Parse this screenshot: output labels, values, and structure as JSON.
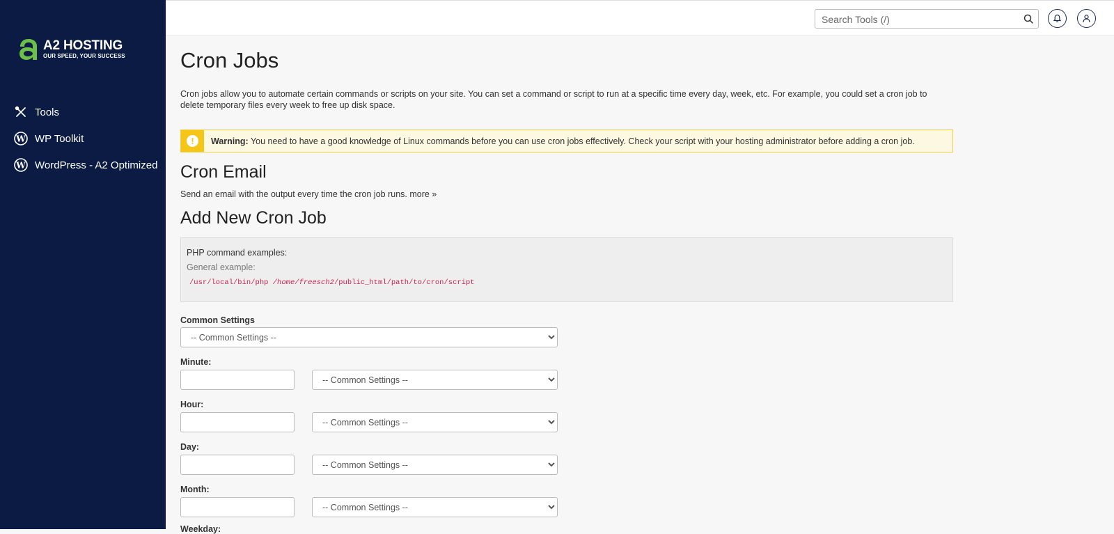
{
  "brand": {
    "name": "A2 HOSTING",
    "tagline": "OUR SPEED, YOUR SUCCESS",
    "colors": {
      "sidebar": "#0b1b44",
      "logo_green": "#6cc04a",
      "warning_yellow": "#f5c518"
    }
  },
  "sidebar": {
    "items": [
      {
        "label": "Tools",
        "icon": "tools-icon"
      },
      {
        "label": "WP Toolkit",
        "icon": "wordpress-icon"
      },
      {
        "label": "WordPress - A2 Optimized",
        "icon": "wordpress-icon"
      }
    ]
  },
  "topbar": {
    "search_placeholder": "Search Tools (/)",
    "icons": [
      "search-icon",
      "bell-icon",
      "user-icon"
    ]
  },
  "page": {
    "title": "Cron Jobs",
    "intro": "Cron jobs allow you to automate certain commands or scripts on your site. You can set a command or script to run at a specific time every day, week, etc. For example, you could set a cron job to delete temporary files every week to free up disk space.",
    "warning_label": "Warning:",
    "warning_text": " You need to have a good knowledge of Linux commands before you can use cron jobs effectively. Check your script with your hosting administrator before adding a cron job."
  },
  "cron_email": {
    "heading": "Cron Email",
    "description": "Send an email with the output every time the cron job runs.",
    "more_link": "more »"
  },
  "add_job": {
    "heading": "Add New Cron Job",
    "examples_heading": "PHP command examples:",
    "general_example_label": "General example:",
    "code_prefix": "/usr/local/bin/php ",
    "code_home": "/home/freesch2",
    "code_suffix": "/public_html/path/to/cron/script",
    "common_settings_label": "Common Settings",
    "common_settings_value": "-- Common Settings --",
    "fields": [
      {
        "label": "Minute:",
        "value": "",
        "select_value": "-- Common Settings --"
      },
      {
        "label": "Hour:",
        "value": "",
        "select_value": "-- Common Settings --"
      },
      {
        "label": "Day:",
        "value": "",
        "select_value": "-- Common Settings --"
      },
      {
        "label": "Month:",
        "value": "",
        "select_value": "-- Common Settings --"
      }
    ],
    "next_label": "Weekday:"
  }
}
